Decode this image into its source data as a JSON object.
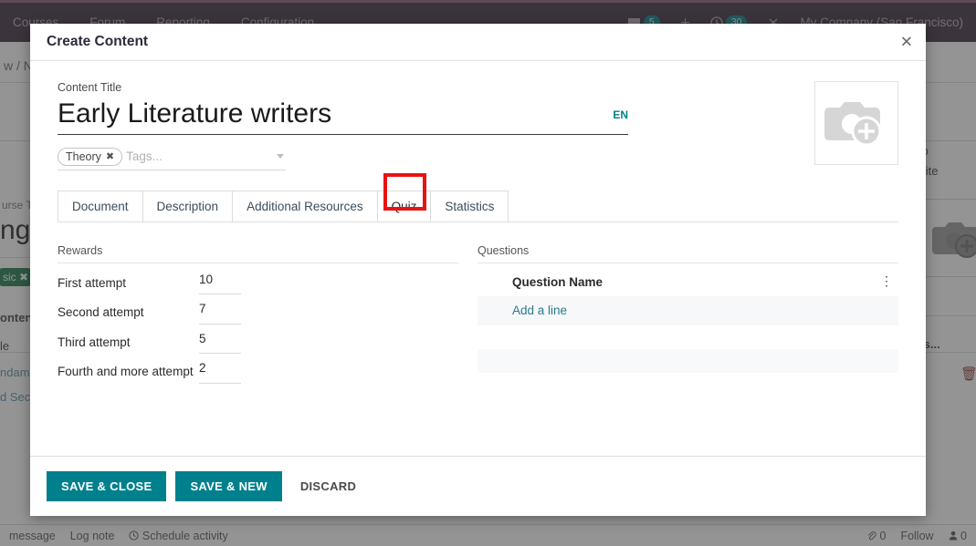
{
  "background": {
    "nav": {
      "items": [
        {
          "label": "Courses"
        },
        {
          "label": "Forum"
        },
        {
          "label": "Reporting"
        },
        {
          "label": "Configuration"
        }
      ],
      "messages_badge": "5",
      "activities_badge": "30",
      "company": "My Company (San Francisco)"
    },
    "breadcrumb": "w / N",
    "course_title_label": "urse Ti",
    "course_title_value": "ngl",
    "course_tag": "sic",
    "labels": {
      "content": "ontent",
      "le": "le",
      "fundamentals": "ndame",
      "second_section": "d Sect",
      "to": "to",
      "website": "osite",
      "is_text": "is..."
    },
    "statusbar": {
      "message": "message",
      "log_note": "Log note",
      "schedule_activity": "Schedule activity",
      "attachment_count": "0",
      "follow": "Follow",
      "follower_count": "0"
    }
  },
  "modal": {
    "title": "Create Content",
    "close_label": "✕",
    "content_title_label": "Content Title",
    "content_title_value": "Early Literature writers",
    "language": "EN",
    "tags": [
      {
        "label": "Theory",
        "remove": "✖"
      }
    ],
    "tags_placeholder": "Tags...",
    "tabs": [
      {
        "label": "Document",
        "active": false
      },
      {
        "label": "Description",
        "active": false
      },
      {
        "label": "Additional Resources",
        "active": false
      },
      {
        "label": "Quiz",
        "active": true,
        "highlighted": true
      },
      {
        "label": "Statistics",
        "active": false
      }
    ],
    "quiz": {
      "rewards_heading": "Rewards",
      "rewards": [
        {
          "label": "First attempt",
          "value": "10"
        },
        {
          "label": "Second attempt",
          "value": "7"
        },
        {
          "label": "Third attempt",
          "value": "5"
        },
        {
          "label": "Fourth and more attempt",
          "value": "2"
        }
      ],
      "questions_heading": "Questions",
      "questions_column_header": "Question Name",
      "options_icon": "⋮",
      "add_line_label": "Add a line",
      "rows": []
    },
    "footer": {
      "save_close": "SAVE & CLOSE",
      "save_new": "SAVE & NEW",
      "discard": "DISCARD"
    }
  },
  "colors": {
    "accent_teal": "#00808c",
    "nav_dark": "#3b2c3c",
    "nav_accent": "#875a7b",
    "highlight_red": "#e81313",
    "tag_green": "#1a7a4c"
  }
}
